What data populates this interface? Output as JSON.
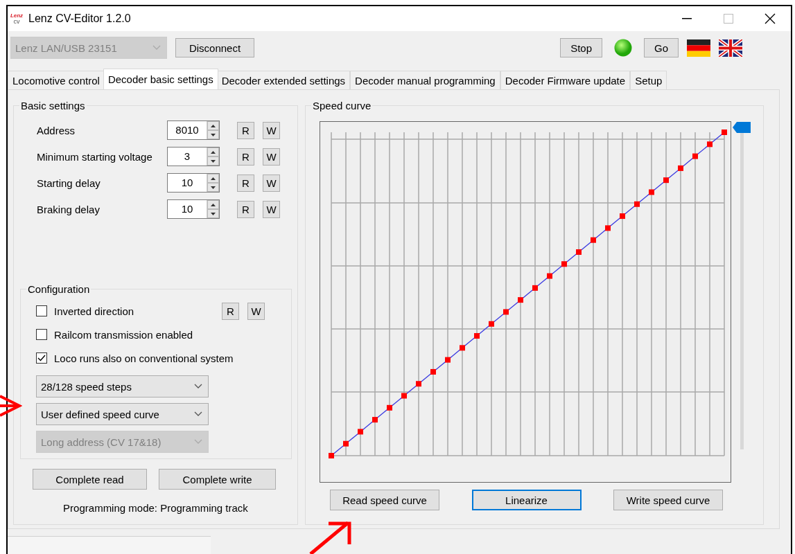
{
  "window": {
    "title": "Lenz CV-Editor 1.2.0",
    "logo": "Lenz",
    "logo_sub": "cv"
  },
  "toolbar": {
    "interface": {
      "value": "Lenz LAN/USB 23151",
      "disabled": true
    },
    "disconnect": "Disconnect",
    "stop": "Stop",
    "power_led": {
      "on": true
    },
    "go": "Go"
  },
  "tabs": [
    {
      "label": "Locomotive control",
      "selected": false
    },
    {
      "label": "Decoder basic settings",
      "selected": true
    },
    {
      "label": "Decoder extended settings",
      "selected": false
    },
    {
      "label": "Decoder manual programming",
      "selected": false
    },
    {
      "label": "Decoder Firmware update",
      "selected": false
    },
    {
      "label": "Setup",
      "selected": false
    }
  ],
  "basic_settings": {
    "title": "Basic settings",
    "fields": [
      {
        "label": "Address",
        "value": "8010",
        "read": "R",
        "write": "W"
      },
      {
        "label": "Minimum starting voltage",
        "value": "3",
        "read": "R",
        "write": "W"
      },
      {
        "label": "Starting delay",
        "value": "10",
        "read": "R",
        "write": "W"
      },
      {
        "label": "Braking delay",
        "value": "10",
        "read": "R",
        "write": "W"
      }
    ]
  },
  "configuration": {
    "title": "Configuration",
    "read": "R",
    "write": "W",
    "checkboxes": [
      {
        "label": "Inverted direction",
        "checked": false,
        "kind": "readwrite"
      },
      {
        "label": "Railcom transmission enabled",
        "checked": false,
        "kind": "plain"
      },
      {
        "label": "Loco runs also on conventional system",
        "checked": true,
        "kind": "plain"
      }
    ],
    "dropdowns": [
      {
        "value": "28/128 speed steps",
        "disabled": false
      },
      {
        "value": "User defined speed curve",
        "disabled": false
      },
      {
        "value": "Long address (CV 17&18)",
        "disabled": true
      }
    ]
  },
  "complete_read": "Complete read",
  "complete_write": "Complete write",
  "programming_mode": "Programming mode: Programming track",
  "speed_curve": {
    "title": "Speed curve",
    "slider": {
      "level": 1
    },
    "buttons": [
      {
        "label": "Read speed curve",
        "focused": false
      },
      {
        "label": "Linearize",
        "focused": true
      },
      {
        "label": "Write speed curve",
        "focused": false
      }
    ]
  }
}
